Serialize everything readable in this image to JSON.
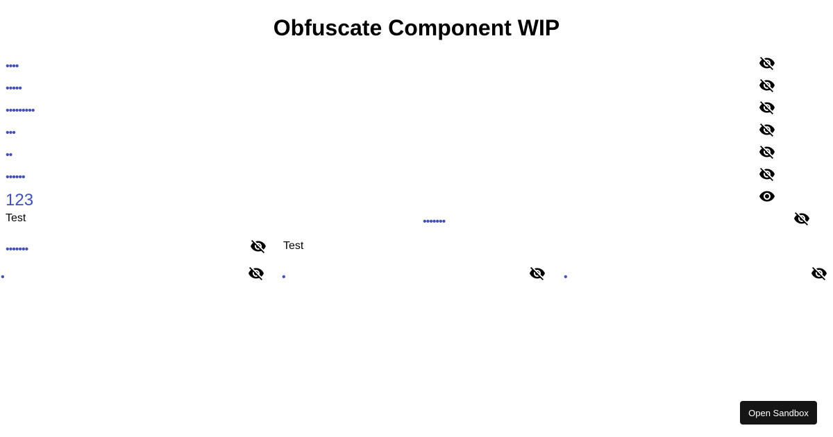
{
  "page": {
    "title": "Obfuscate Component WIP"
  },
  "column_list": {
    "items": [
      {
        "masked": "••••",
        "icon": "eye-off-icon"
      },
      {
        "masked": "•••••",
        "icon": "eye-off-icon"
      },
      {
        "masked": "•••••••••",
        "icon": "eye-off-icon"
      },
      {
        "masked": "•••",
        "icon": "eye-off-icon"
      },
      {
        "masked": "••",
        "icon": "eye-off-icon"
      },
      {
        "masked": "••••••",
        "icon": "eye-off-icon"
      },
      {
        "revealed": "123",
        "icon": "eye-icon"
      }
    ]
  },
  "full_width_row": {
    "label": "Test",
    "masked": "•••••••",
    "icon": "eye-off-icon"
  },
  "grid": {
    "row1": {
      "col1_masked": "•••••••",
      "col1_icon": "eye-off-icon",
      "col2_text": "Test"
    },
    "row2": [
      {
        "masked": "•",
        "icon": "eye-off-icon"
      },
      {
        "masked": "•",
        "icon": "eye-off-icon"
      },
      {
        "masked": "•",
        "icon": "eye-off-icon"
      }
    ]
  },
  "footer": {
    "sandbox_label": "Open Sandbox"
  },
  "colors": {
    "masked_text": "#3f51b5",
    "button_bg": "#151515"
  }
}
